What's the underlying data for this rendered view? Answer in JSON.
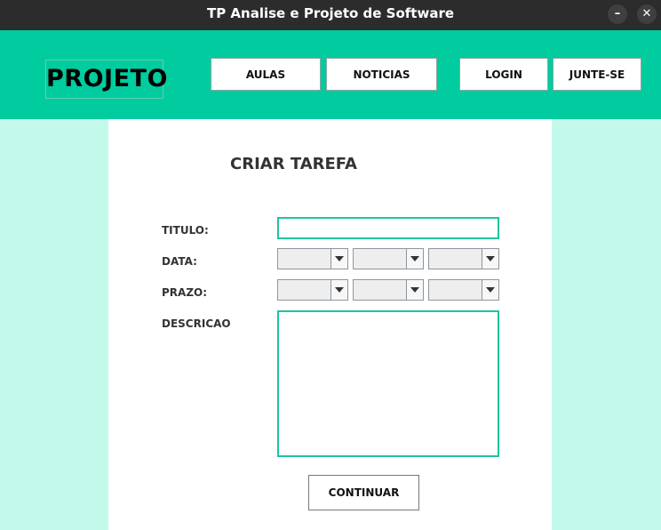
{
  "window": {
    "title": "TP Analise e Projeto de Software",
    "minimize_glyph": "–",
    "close_glyph": "✕"
  },
  "header": {
    "logo": "PROJETO",
    "nav": [
      "AULAS",
      "NOTICIAS",
      "LOGIN",
      "JUNTE-SE"
    ]
  },
  "form": {
    "title": "CRIAR TAREFA",
    "titulo_label": "TITULO:",
    "titulo_value": "",
    "data_label": "DATA:",
    "data_values": [
      "",
      "",
      ""
    ],
    "prazo_label": "PRAZO:",
    "prazo_values": [
      "",
      "",
      ""
    ],
    "descricao_label": "DESCRICAO",
    "descricao_value": "",
    "continue_label": "CONTINUAR"
  },
  "colors": {
    "header": "#00cc9f",
    "background": "#c3f9ea",
    "field_border": "#1ec49e"
  }
}
